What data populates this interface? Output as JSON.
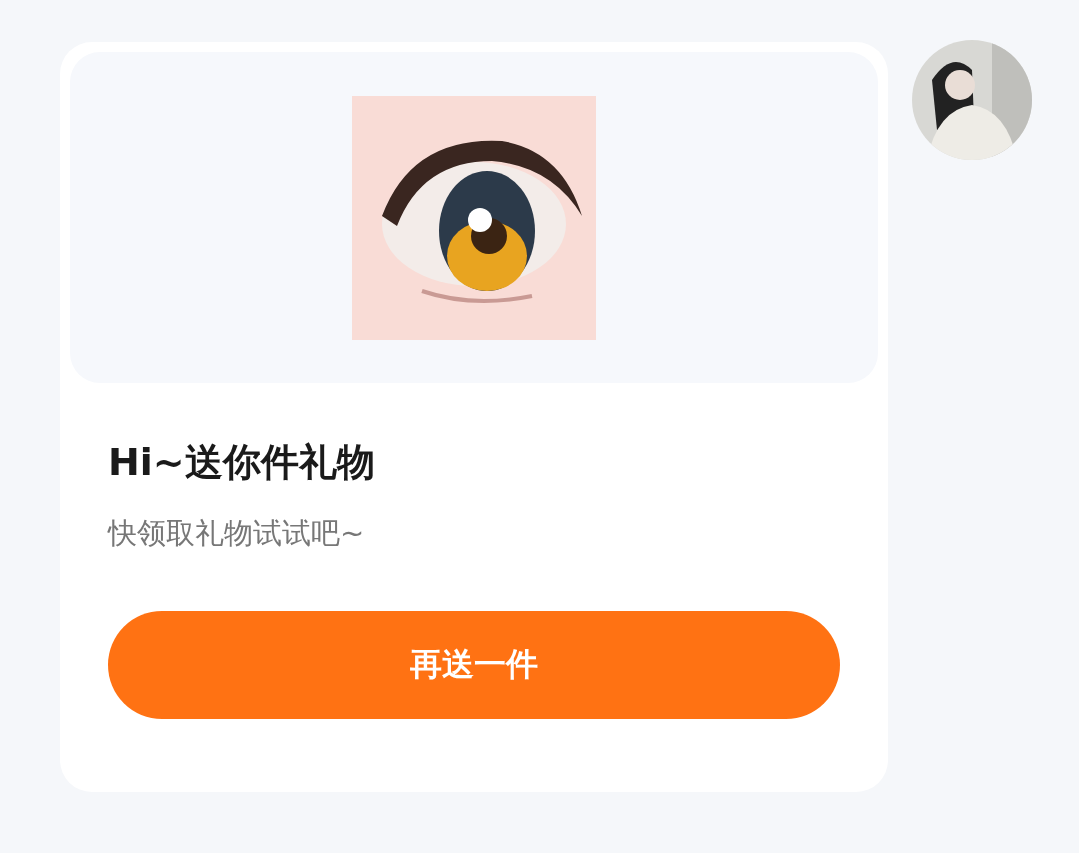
{
  "gift_card": {
    "title": "Hi~送你件礼物",
    "subtitle": "快领取礼物试试吧~",
    "button": "再送一件"
  }
}
